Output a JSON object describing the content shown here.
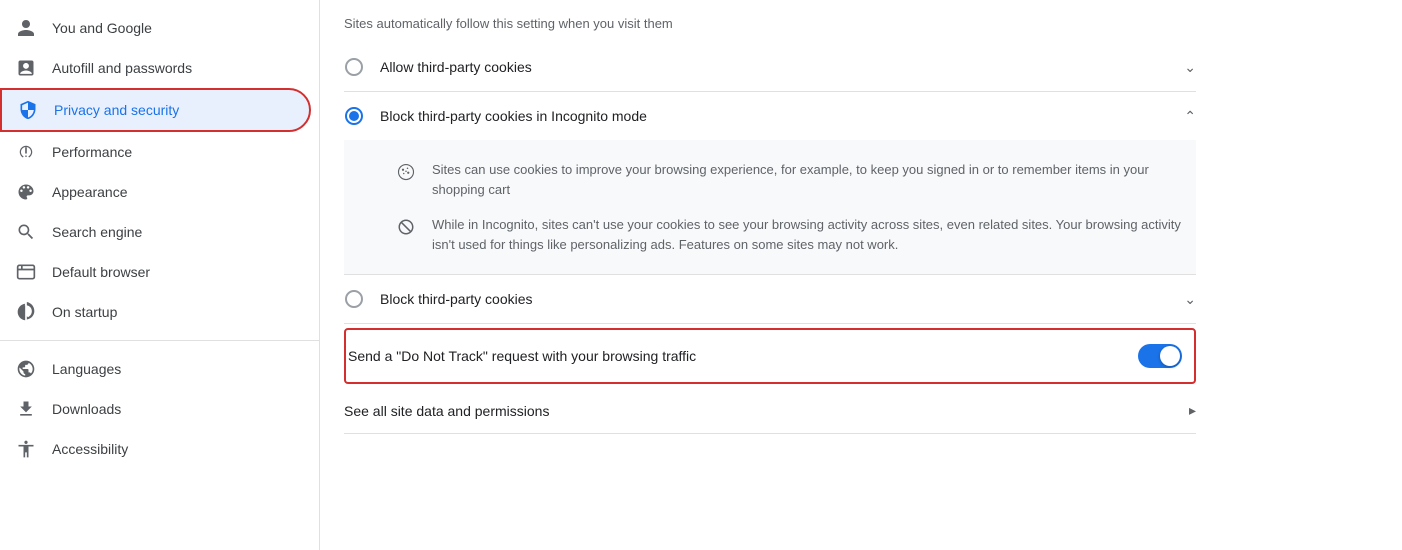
{
  "sidebar": {
    "items": [
      {
        "id": "you-and-google",
        "label": "You and Google",
        "icon": "person"
      },
      {
        "id": "autofill",
        "label": "Autofill and passwords",
        "icon": "autofill"
      },
      {
        "id": "privacy",
        "label": "Privacy and security",
        "icon": "shield",
        "active": true
      },
      {
        "id": "performance",
        "label": "Performance",
        "icon": "performance"
      },
      {
        "id": "appearance",
        "label": "Appearance",
        "icon": "appearance"
      },
      {
        "id": "search-engine",
        "label": "Search engine",
        "icon": "search"
      },
      {
        "id": "default-browser",
        "label": "Default browser",
        "icon": "browser"
      },
      {
        "id": "on-startup",
        "label": "On startup",
        "icon": "startup"
      },
      {
        "id": "languages",
        "label": "Languages",
        "icon": "globe"
      },
      {
        "id": "downloads",
        "label": "Downloads",
        "icon": "download"
      },
      {
        "id": "accessibility",
        "label": "Accessibility",
        "icon": "accessibility"
      }
    ]
  },
  "main": {
    "top_subtitle": "Sites automatically follow this setting when you visit them",
    "options": [
      {
        "id": "allow-third-party",
        "label": "Allow third-party cookies",
        "selected": false,
        "expanded": false,
        "chevron": "down"
      },
      {
        "id": "block-incognito",
        "label": "Block third-party cookies in Incognito mode",
        "selected": true,
        "expanded": true,
        "chevron": "up"
      },
      {
        "id": "block-all",
        "label": "Block third-party cookies",
        "selected": false,
        "expanded": false,
        "chevron": "down"
      }
    ],
    "expanded_items": [
      {
        "icon": "cookie",
        "text": "Sites can use cookies to improve your browsing experience, for example, to keep you signed in or to remember items in your shopping cart"
      },
      {
        "icon": "block",
        "text": "While in Incognito, sites can't use your cookies to see your browsing activity across sites, even related sites. Your browsing activity isn't used for things like personalizing ads. Features on some sites may not work."
      }
    ],
    "dnt_row": {
      "label": "Send a \"Do Not Track\" request with your browsing traffic",
      "toggle_on": true
    },
    "site_data_row": {
      "label": "See all site data and permissions"
    }
  }
}
